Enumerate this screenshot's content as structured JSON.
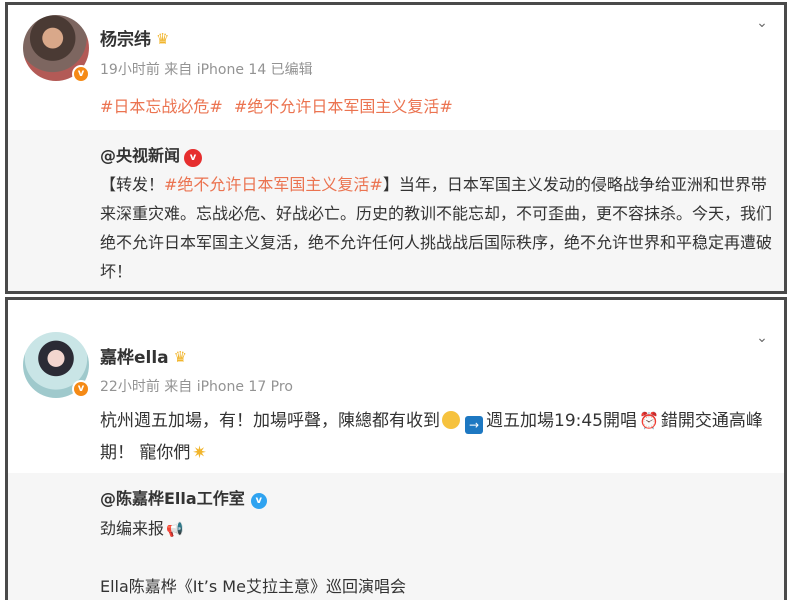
{
  "posts": [
    {
      "author": "杨宗纬",
      "meta": "19小时前 来自 iPhone 14 已编辑",
      "hashtags": [
        "#日本忘战必危#",
        "#绝不允许日本军国主义复活#"
      ],
      "repost": {
        "author": "@央视新闻",
        "text_prefix": "【转发！",
        "text_hashtag": "#绝不允许日本军国主义复活#",
        "text_body": "】当年，日本军国主义发动的侵略战争给亚洲和世界带来深重灾难。忘战必危、好战必亡。历史的教训不能忘却，不可歪曲，更不容抹杀。今天，我们绝不允许日本军国主义复活，绝不允许任何人挑战战后国际秩序，绝不允许世界和平稳定再遭破坏！"
      }
    },
    {
      "author": "嘉桦ella",
      "meta": "22小时前 来自 iPhone 17 Pro",
      "text_1": "杭州週五加場，有！加場呼聲，陳總都有收到",
      "text_2": "週五加場19:45開唱",
      "text_3": "錯開交通高峰期！ 寵你們",
      "repost": {
        "author": "@陈嘉桦Ella工作室",
        "line1": "劲编来报",
        "line2": "Ella陈嘉桦《It’s Me艾拉主意》巡回演唱会"
      }
    }
  ],
  "icons": {
    "verified_badge": "v",
    "crown": "♛",
    "chevron": "⌄",
    "arrow": "→",
    "clock": "⏰",
    "hug": "✷",
    "megaphone": "📢"
  },
  "colors": {
    "accent": "#eb7350",
    "meta": "#939393",
    "repost_bg": "#f6f6f6",
    "orange_badge": "#f58a16"
  }
}
